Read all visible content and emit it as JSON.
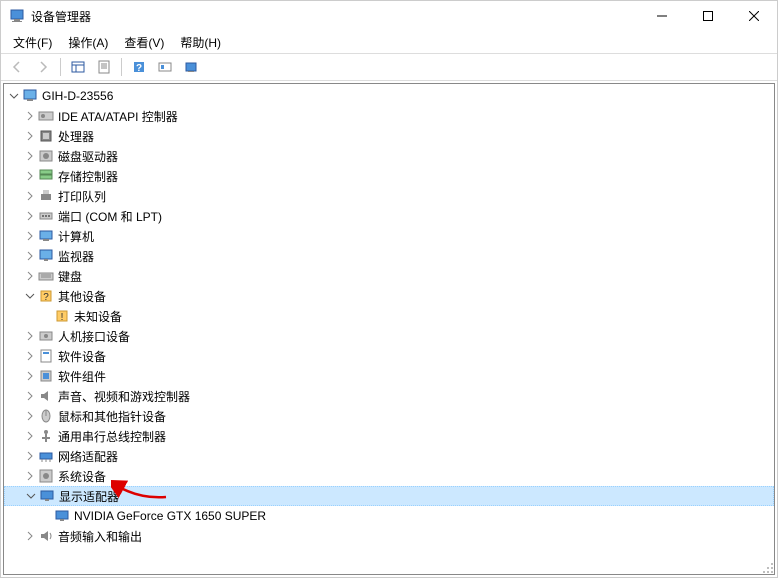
{
  "window": {
    "title": "设备管理器"
  },
  "menu": {
    "file": "文件(F)",
    "action": "操作(A)",
    "view": "查看(V)",
    "help": "帮助(H)"
  },
  "tree": {
    "root": {
      "label": "GIH-D-23556",
      "expanded": true
    },
    "nodes": [
      {
        "label": "IDE ATA/ATAPI 控制器",
        "expandable": true,
        "icon": "ide"
      },
      {
        "label": "处理器",
        "expandable": true,
        "icon": "cpu"
      },
      {
        "label": "磁盘驱动器",
        "expandable": true,
        "icon": "disk"
      },
      {
        "label": "存储控制器",
        "expandable": true,
        "icon": "storage"
      },
      {
        "label": "打印队列",
        "expandable": true,
        "icon": "printer"
      },
      {
        "label": "端口 (COM 和 LPT)",
        "expandable": true,
        "icon": "port"
      },
      {
        "label": "计算机",
        "expandable": true,
        "icon": "computer"
      },
      {
        "label": "监视器",
        "expandable": true,
        "icon": "monitor"
      },
      {
        "label": "键盘",
        "expandable": true,
        "icon": "keyboard"
      },
      {
        "label": "其他设备",
        "expandable": true,
        "expanded": true,
        "icon": "other",
        "children": [
          {
            "label": "未知设备",
            "icon": "unknown"
          }
        ]
      },
      {
        "label": "人机接口设备",
        "expandable": true,
        "icon": "hid"
      },
      {
        "label": "软件设备",
        "expandable": true,
        "icon": "software"
      },
      {
        "label": "软件组件",
        "expandable": true,
        "icon": "component"
      },
      {
        "label": "声音、视频和游戏控制器",
        "expandable": true,
        "icon": "sound"
      },
      {
        "label": "鼠标和其他指针设备",
        "expandable": true,
        "icon": "mouse"
      },
      {
        "label": "通用串行总线控制器",
        "expandable": true,
        "icon": "usb"
      },
      {
        "label": "网络适配器",
        "expandable": true,
        "icon": "network"
      },
      {
        "label": "系统设备",
        "expandable": true,
        "icon": "system"
      },
      {
        "label": "显示适配器",
        "expandable": true,
        "expanded": true,
        "selected": true,
        "icon": "display",
        "children": [
          {
            "label": "NVIDIA GeForce GTX 1650 SUPER",
            "icon": "display"
          }
        ]
      },
      {
        "label": "音频输入和输出",
        "expandable": true,
        "icon": "audio"
      }
    ]
  }
}
